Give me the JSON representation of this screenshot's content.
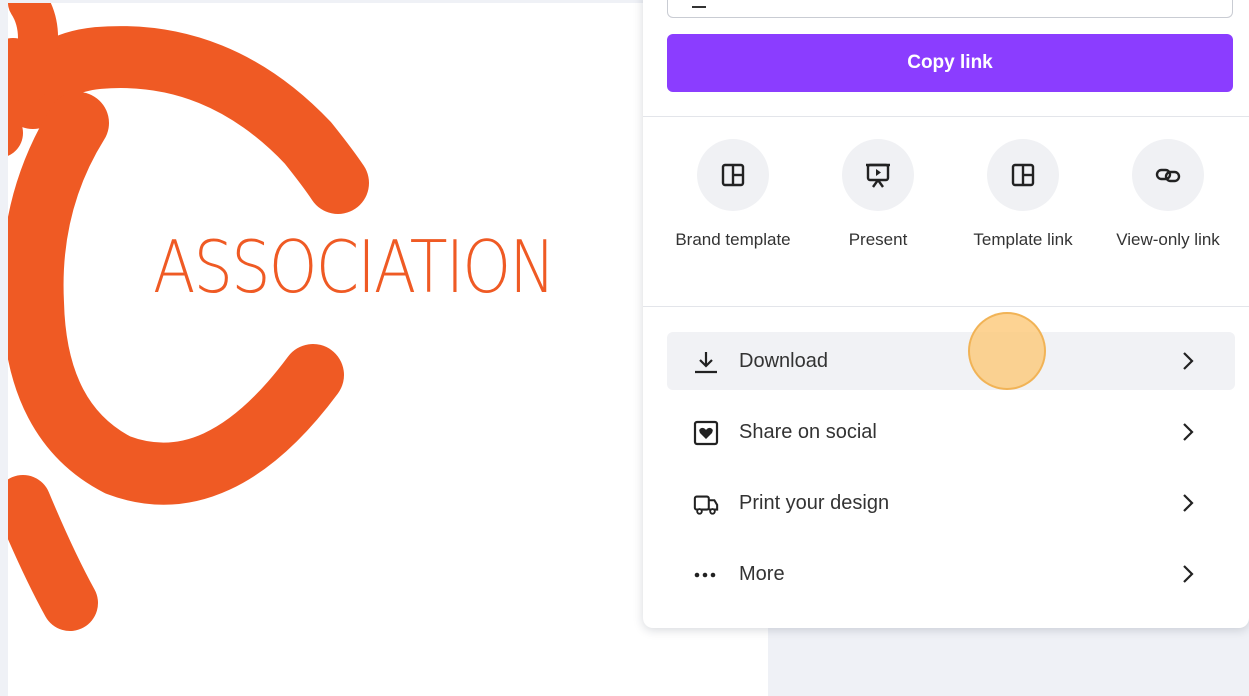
{
  "canvas": {
    "text": "ASSOCIATION",
    "accent": "#ef5a24"
  },
  "share_panel": {
    "link_input": {
      "value": ""
    },
    "copy_link_label": "Copy link",
    "copy_link_color": "#8b3dff",
    "options": [
      {
        "icon": "brand-template-icon",
        "label": "Brand template"
      },
      {
        "icon": "present-icon",
        "label": "Present"
      },
      {
        "icon": "template-link-icon",
        "label": "Template link"
      },
      {
        "icon": "view-only-link-icon",
        "label": "View-only link"
      }
    ],
    "actions": [
      {
        "icon": "download-icon",
        "label": "Download",
        "active": true
      },
      {
        "icon": "share-social-icon",
        "label": "Share on social"
      },
      {
        "icon": "print-truck-icon",
        "label": "Print your design"
      },
      {
        "icon": "more-dots-icon",
        "label": "More"
      }
    ]
  }
}
